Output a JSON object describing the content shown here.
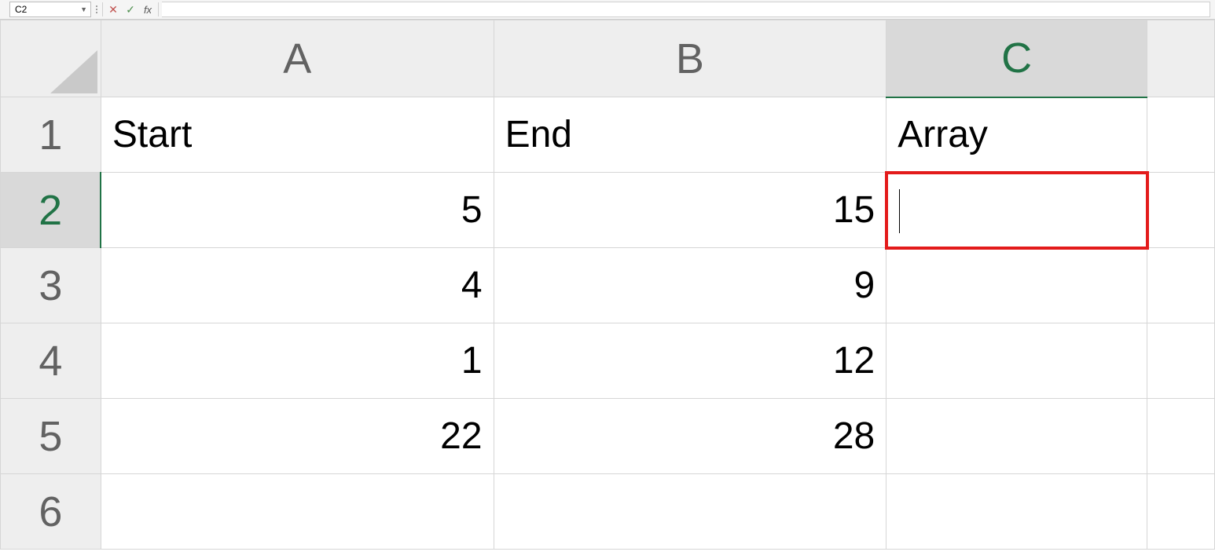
{
  "formula_bar": {
    "cell_ref": "C2",
    "cancel_glyph": "✕",
    "accept_glyph": "✓",
    "fx_label": "fx",
    "formula_value": ""
  },
  "columns": [
    {
      "id": "A",
      "label": "A",
      "selected": false
    },
    {
      "id": "B",
      "label": "B",
      "selected": false
    },
    {
      "id": "C",
      "label": "C",
      "selected": true
    },
    {
      "id": "D",
      "label": "",
      "selected": false
    }
  ],
  "rows": [
    {
      "n": "1",
      "selected": false,
      "cells": {
        "A": "Start",
        "B": "End",
        "C": "Array",
        "D": ""
      },
      "types": {
        "A": "txt",
        "B": "txt",
        "C": "txt",
        "D": "txt"
      }
    },
    {
      "n": "2",
      "selected": true,
      "cells": {
        "A": "5",
        "B": "15",
        "C": "",
        "D": ""
      },
      "types": {
        "A": "num",
        "B": "num",
        "C": "txt",
        "D": "txt"
      }
    },
    {
      "n": "3",
      "selected": false,
      "cells": {
        "A": "4",
        "B": "9",
        "C": "",
        "D": ""
      },
      "types": {
        "A": "num",
        "B": "num",
        "C": "txt",
        "D": "txt"
      }
    },
    {
      "n": "4",
      "selected": false,
      "cells": {
        "A": "1",
        "B": "12",
        "C": "",
        "D": ""
      },
      "types": {
        "A": "num",
        "B": "num",
        "C": "txt",
        "D": "txt"
      }
    },
    {
      "n": "5",
      "selected": false,
      "cells": {
        "A": "22",
        "B": "28",
        "C": "",
        "D": ""
      },
      "types": {
        "A": "num",
        "B": "num",
        "C": "txt",
        "D": "txt"
      }
    },
    {
      "n": "6",
      "selected": false,
      "cells": {
        "A": "",
        "B": "",
        "C": "",
        "D": ""
      },
      "types": {
        "A": "txt",
        "B": "txt",
        "C": "txt",
        "D": "txt"
      }
    }
  ],
  "active_cell": {
    "col": "C",
    "row": "2"
  }
}
